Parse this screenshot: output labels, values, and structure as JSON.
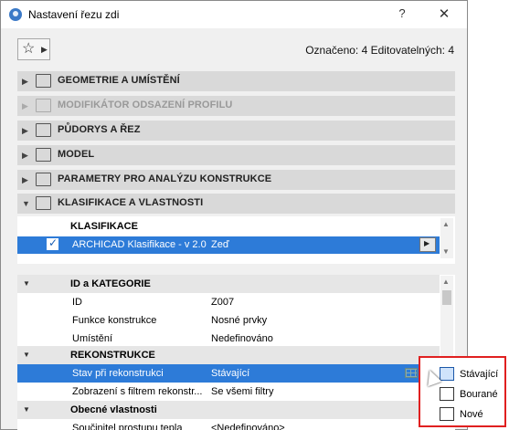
{
  "window": {
    "title": "Nastavení řezu zdi",
    "help_label": "?",
    "close_label": "✕"
  },
  "toolbar": {
    "favorites_icon": "star-icon",
    "selected_info": "Označeno: 4 Editovatelných: 4"
  },
  "sections": [
    {
      "label": "GEOMETRIE A UMÍSTĚNÍ",
      "icon": "geometry-icon",
      "enabled": true
    },
    {
      "label": "MODIFIKÁTOR ODSAZENÍ PROFILU",
      "icon": "profile-offset-icon",
      "enabled": false
    },
    {
      "label": "PŮDORYS A ŘEZ",
      "icon": "floorplan-icon",
      "enabled": true
    },
    {
      "label": "MODEL",
      "icon": "model-icon",
      "enabled": true
    },
    {
      "label": "PARAMETRY PRO ANALÝZU KONSTRUKCE",
      "icon": "structural-analysis-icon",
      "enabled": true
    },
    {
      "label": "KLASIFIKACE A VLASTNOSTI",
      "icon": "classification-icon",
      "enabled": true,
      "expanded": true
    }
  ],
  "classification": {
    "header": "KLASIFIKACE",
    "row": {
      "checked": true,
      "name": "ARCHICAD Klasifikace - v 2.0",
      "value": "Zeď"
    }
  },
  "properties": {
    "groups": [
      {
        "label": "ID a KATEGORIE",
        "rows": [
          {
            "key": "ID",
            "value": "Z007"
          },
          {
            "key": "Funkce konstrukce",
            "value": "Nosné prvky"
          },
          {
            "key": "Umístění",
            "value": "Nedefinováno"
          }
        ]
      },
      {
        "label": "REKONSTRUKCE",
        "rows": [
          {
            "key": "Stav při rekonstrukci",
            "value": "Stávající",
            "selected": true
          },
          {
            "key": "Zobrazení s filtrem rekonstr...",
            "value": "Se všemi filtry"
          }
        ]
      },
      {
        "label": "Obecné vlastnosti",
        "rows": [
          {
            "key": "Součinitel prostupu tepla",
            "value": "<Nedefinováno>"
          }
        ]
      }
    ]
  },
  "renovation_popup": {
    "items": [
      {
        "label": "Stávající",
        "icon": "existing-icon",
        "active": true
      },
      {
        "label": "Bourané",
        "icon": "demolished-icon",
        "active": false
      },
      {
        "label": "Nové",
        "icon": "new-icon",
        "active": false
      }
    ],
    "highlight_color": "#e02020"
  },
  "colors": {
    "selection": "#2d7bd8",
    "section_bg": "#d9d9d9"
  }
}
